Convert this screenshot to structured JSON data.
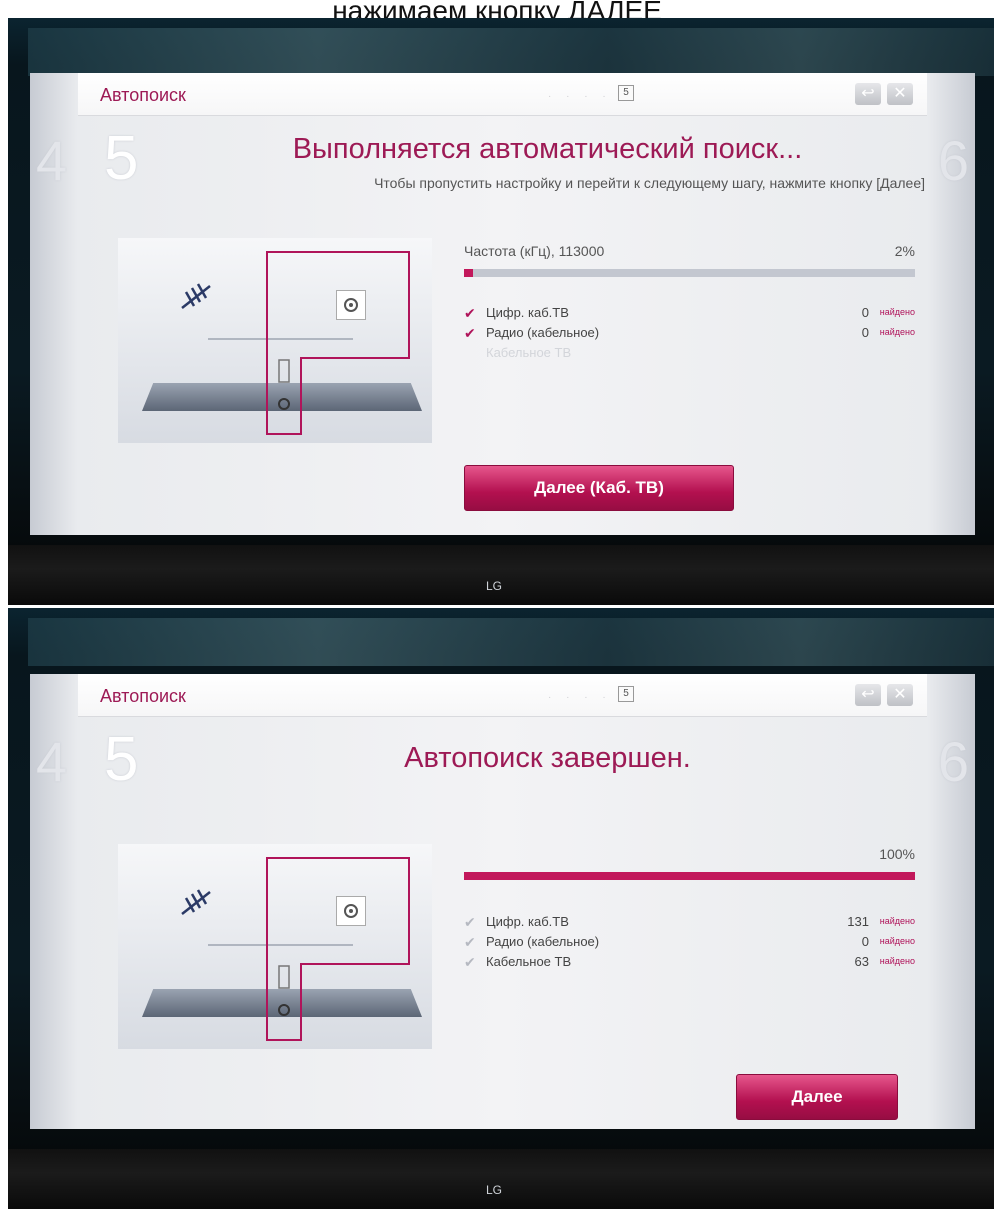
{
  "caption": "нажимаем кнопку ДАЛЕЕ",
  "brand": "LG",
  "screens": [
    {
      "window_title": "Автопоиск",
      "page_indicator": "5",
      "step_prev": "4",
      "step_current": "5",
      "step_next": "6",
      "heading": "Выполняется автоматический поиск...",
      "subheading": "Чтобы пропустить настройку и перейти к следующему шагу, нажмите кнопку [Далее]",
      "frequency_label": "Частота (кГц), 113000",
      "progress_label": "2%",
      "progress": 0.02,
      "items": [
        {
          "label": "Цифр. каб.ТВ",
          "count": "0",
          "found": "найдено"
        },
        {
          "label": "Радио (кабельное)",
          "count": "0",
          "found": "найдено"
        },
        {
          "label": "Кабельное ТВ",
          "count": "",
          "found": ""
        }
      ],
      "button_label": "Далее (Каб. ТВ)"
    },
    {
      "window_title": "Автопоиск",
      "page_indicator": "5",
      "step_prev": "4",
      "step_current": "5",
      "step_next": "6",
      "heading": "Автопоиск завершен.",
      "progress_label": "100%",
      "progress": 1.0,
      "items": [
        {
          "label": "Цифр. каб.ТВ",
          "count": "131",
          "found": "найдено"
        },
        {
          "label": "Радио (кабельное)",
          "count": "0",
          "found": "найдено"
        },
        {
          "label": "Кабельное ТВ",
          "count": "63",
          "found": "найдено"
        }
      ],
      "button_label": "Далее"
    }
  ],
  "colors": {
    "accent": "#9d1a55",
    "button": "#c2185b",
    "progress_track": "#c3c7d0"
  },
  "icons": [
    "checkmark-icon",
    "back-icon",
    "close-icon",
    "antenna-icon",
    "socket-icon"
  ]
}
